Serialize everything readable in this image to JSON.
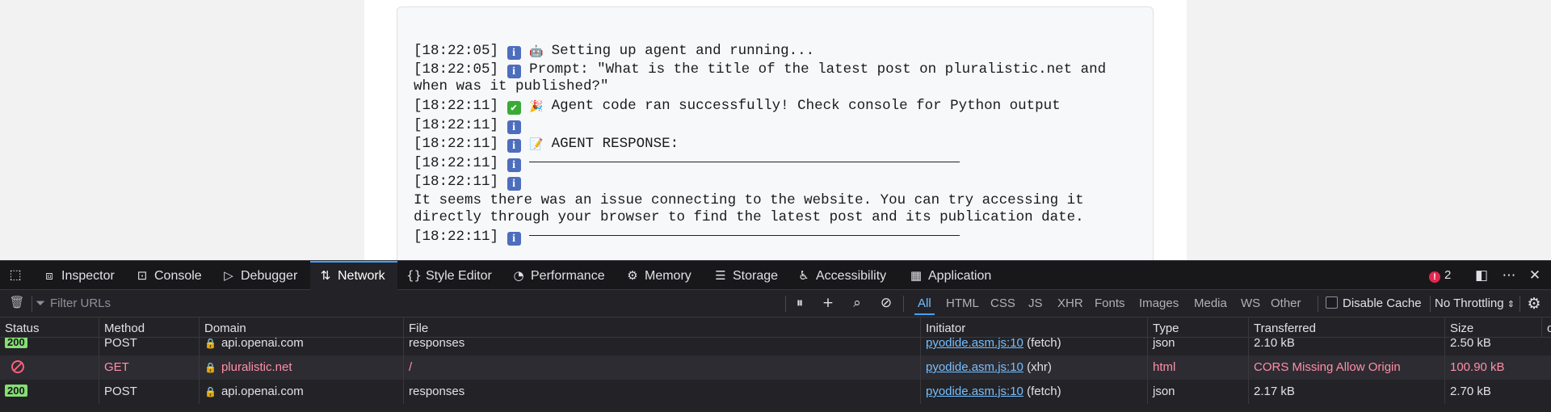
{
  "log": {
    "lines": [
      {
        "ts": "[18:22:05]",
        "icon": "info",
        "emoji": "🤖",
        "text": "Setting up agent and running..."
      },
      {
        "ts": "[18:22:05]",
        "icon": "info",
        "emoji": "",
        "text": "Prompt: \"What is the title of the latest post on pluralistic.net and when was it published?\""
      },
      {
        "ts": "[18:22:11]",
        "icon": "check",
        "emoji": "🎉",
        "text": "Agent code ran successfully! Check console for Python output"
      },
      {
        "ts": "[18:22:11]",
        "icon": "info",
        "emoji": "",
        "text": ""
      },
      {
        "ts": "[18:22:11]",
        "icon": "info",
        "emoji": "📝",
        "text": "AGENT RESPONSE:"
      },
      {
        "ts": "[18:22:11]",
        "icon": "info",
        "emoji": "",
        "text": "rule"
      },
      {
        "ts": "[18:22:11]",
        "icon": "info",
        "emoji": "",
        "text": ""
      }
    ],
    "response_text": "It seems there was an issue connecting to the website. You can try accessing it directly through your browser to find the latest post and its publication date.",
    "last_ts": "[18:22:11]"
  },
  "devtools": {
    "tabs": [
      {
        "label": "Inspector",
        "icon": "inspector-icon"
      },
      {
        "label": "Console",
        "icon": "console-icon"
      },
      {
        "label": "Debugger",
        "icon": "debugger-icon"
      },
      {
        "label": "Network",
        "icon": "network-icon",
        "active": true
      },
      {
        "label": "Style Editor",
        "icon": "style-editor-icon"
      },
      {
        "label": "Performance",
        "icon": "performance-icon"
      },
      {
        "label": "Memory",
        "icon": "memory-icon"
      },
      {
        "label": "Storage",
        "icon": "storage-icon"
      },
      {
        "label": "Accessibility",
        "icon": "accessibility-icon"
      },
      {
        "label": "Application",
        "icon": "application-icon"
      }
    ],
    "error_count": "2",
    "filter_placeholder": "Filter URLs",
    "filter_types": [
      "All",
      "HTML",
      "CSS",
      "JS",
      "XHR",
      "Fonts",
      "Images",
      "Media",
      "WS",
      "Other"
    ],
    "active_filter": "All",
    "disable_cache_label": "Disable Cache",
    "throttling_label": "No Throttling",
    "columns": [
      "Status",
      "Method",
      "Domain",
      "File",
      "Initiator",
      "Type",
      "Transferred",
      "Size",
      "o"
    ],
    "requests": [
      {
        "status": "200",
        "method": "POST",
        "domain": "api.openai.com",
        "file": "responses",
        "initiator_link": "pyodide.asm.js:10",
        "initiator_cause": "(fetch)",
        "type": "json",
        "transferred": "2.10 kB",
        "size": "2.50 kB",
        "error": false
      },
      {
        "status": "blocked",
        "method": "GET",
        "domain": "pluralistic.net",
        "file": "/",
        "initiator_link": "pyodide.asm.js:10",
        "initiator_cause": "(xhr)",
        "type": "html",
        "transferred": "CORS Missing Allow Origin",
        "size": "100.90 kB",
        "error": true
      },
      {
        "status": "200",
        "method": "POST",
        "domain": "api.openai.com",
        "file": "responses",
        "initiator_link": "pyodide.asm.js:10",
        "initiator_cause": "(fetch)",
        "type": "json",
        "transferred": "2.17 kB",
        "size": "2.70 kB",
        "error": false
      }
    ],
    "colors": {
      "accent": "#45a1ff",
      "error": "#ff8fa8",
      "ok_badge": "#86de74"
    }
  }
}
